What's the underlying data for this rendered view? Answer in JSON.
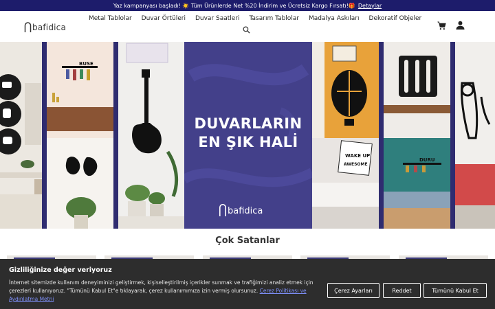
{
  "announcement": {
    "text": "Yaz kampanyası başladı! ☀️ Tüm Ürünlerde Net %20 İndirim ve Ücretsiz Kargo Fırsatı!🎁",
    "link_label": "Detaylar"
  },
  "header": {
    "logo_text": "bafidica",
    "nav": [
      "Metal Tablolar",
      "Duvar Örtüleri",
      "Duvar Saatleri",
      "Tasarım Tablolar",
      "Madalya Askıları",
      "Dekoratif Objeler"
    ],
    "icons": [
      "search-icon",
      "cart-icon",
      "user-icon"
    ]
  },
  "hero": {
    "title_line1": "DUVARLARIN",
    "title_line2": "EN ŞIK HALİ",
    "logo_text": "bafidica",
    "decor_text": {
      "buse": "BUSE",
      "wake": "WAKE UP",
      "awesome": "AWESOME",
      "duru": "DURU"
    },
    "accent_color": "#43408a"
  },
  "section": {
    "title": "Çok Satanlar"
  },
  "cookie": {
    "title": "Gizliliğinize değer veriyoruz",
    "text": "İnternet sitemizde kullanım deneyiminizi geliştirmek, kişiselleştirilmiş içerikler sunmak ve trafiğimizi analiz etmek için çerezleri kullanıyoruz. \"Tümünü Kabul Et\"e tıklayarak, çerez kullanımımıza izin vermiş olursunuz.",
    "link_label": "Çerez Politikası ve Aydınlatma Metni",
    "buttons": {
      "settings": "Çerez Ayarları",
      "reject": "Reddet",
      "accept": "Tümünü Kabul Et"
    }
  }
}
